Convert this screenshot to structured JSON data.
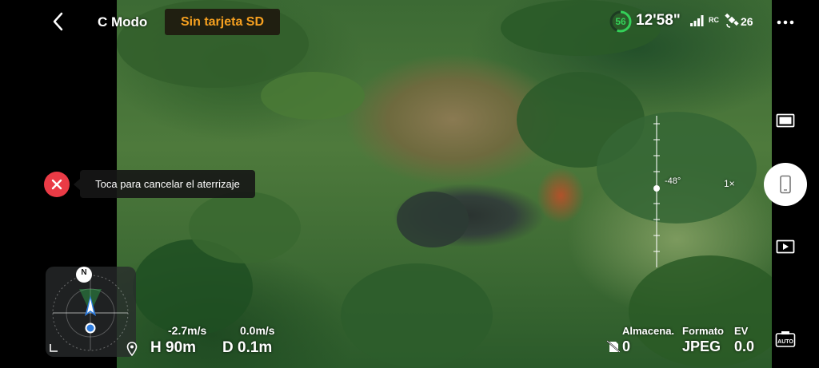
{
  "header": {
    "back_icon": "chevron-left-icon",
    "mode": "C Modo",
    "sd_status": "Sin tarjeta SD",
    "battery_percent": "56",
    "flight_time": "12'58\"",
    "rc_label": "RC",
    "satellite_count": "26",
    "more_icon": "more-dots-icon"
  },
  "landing": {
    "cancel_icon": "close-icon",
    "tooltip": "Toca para cancelar el aterrizaje"
  },
  "camera": {
    "gimbal_angle": "-48°",
    "zoom": "1×",
    "storage_label": "Almacena.",
    "storage_value": "0",
    "format_label": "Formato",
    "format_value": "JPEG",
    "ev_label": "EV",
    "ev_value": "0.0"
  },
  "telemetry": {
    "vertical_speed": "-2.7m/s",
    "horizontal_speed": "0.0m/s",
    "height": "H 90m",
    "distance": "D 0.1m"
  },
  "radar": {
    "north_label": "N"
  },
  "colors": {
    "accent_orange": "#f7a120",
    "battery_green": "#34d058",
    "cancel_red": "#ea3b46",
    "aircraft_blue": "#2e7de0"
  }
}
